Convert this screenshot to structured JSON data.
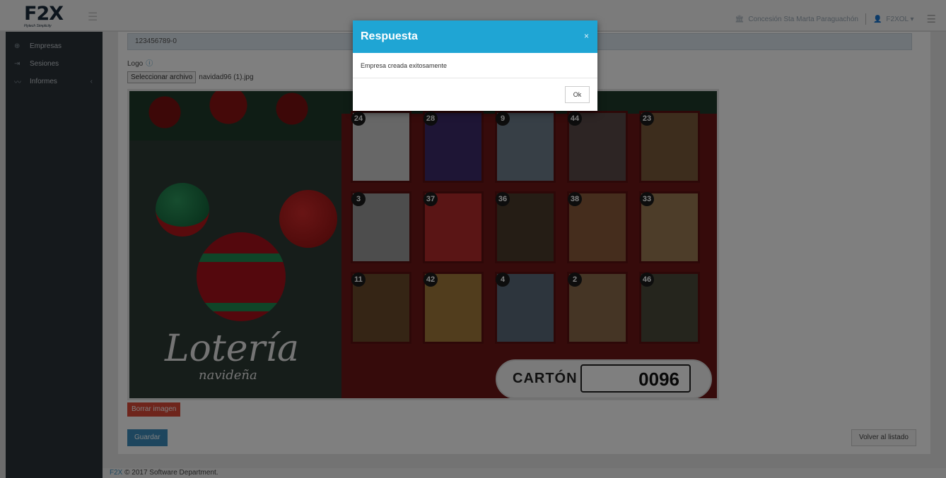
{
  "app": {
    "logo_text": "F2X",
    "logo_tagline": "Flytech Simplicity"
  },
  "topbar": {
    "concession": "Concesión Sta Marta Paraguachón",
    "user": "F2XOL"
  },
  "sidebar": {
    "items": [
      {
        "label": "Empresas",
        "icon": "globe-icon"
      },
      {
        "label": "Sesiones",
        "icon": "sign-in-icon"
      },
      {
        "label": "Informes",
        "icon": "chart-line-icon"
      }
    ]
  },
  "form": {
    "nit_value": "123456789-0",
    "logo_label": "Logo",
    "file_button": "Seleccionar archivo",
    "file_name": "navidad96 (1).jpg",
    "delete_image": "Borrar imagen",
    "save": "Guardar",
    "back": "Volver al listado"
  },
  "card_image": {
    "title": "Lotería",
    "subtitle": "navideña",
    "carton_label": "CARTÓN",
    "carton_number": "0096",
    "tiles": [
      "24",
      "28",
      "9",
      "44",
      "23",
      "3",
      "37",
      "36",
      "38",
      "33",
      "11",
      "42",
      "4",
      "2",
      "46"
    ]
  },
  "footer": {
    "brand": "F2X",
    "text": " © 2017 Software Department."
  },
  "modal": {
    "title": "Respuesta",
    "close": "×",
    "message": "Empresa creada exitosamente",
    "ok": "Ok"
  }
}
